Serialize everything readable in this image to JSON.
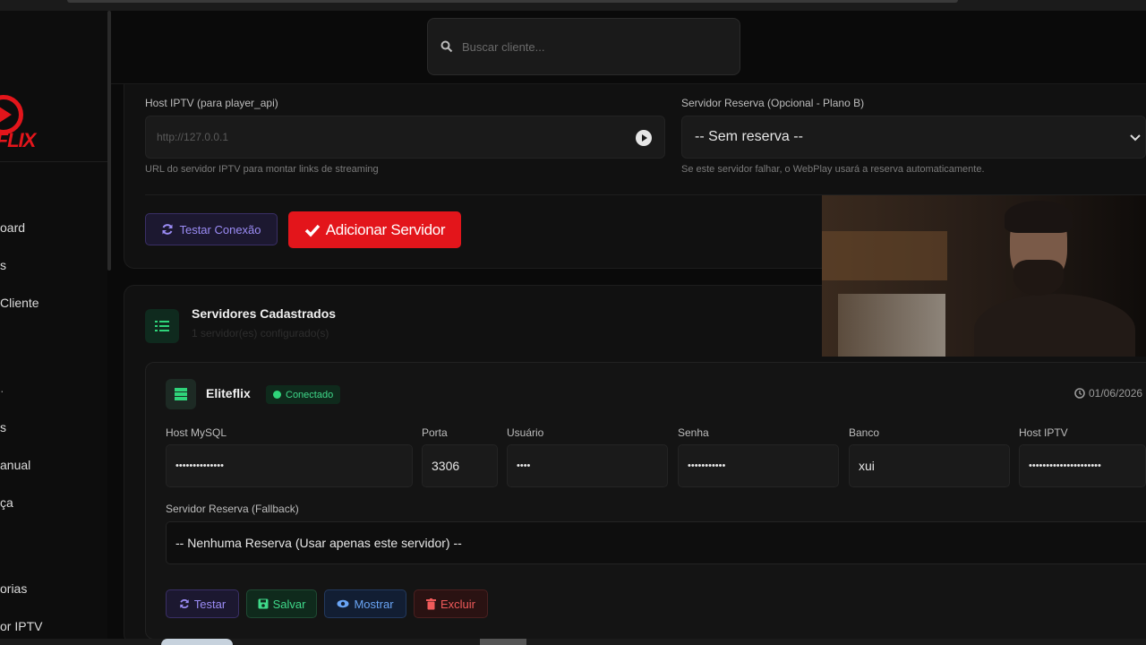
{
  "brand": {
    "logo_text": "EFLIX"
  },
  "search": {
    "placeholder": "Buscar cliente..."
  },
  "sidebar": {
    "items": [
      {
        "label": "oard"
      },
      {
        "label": "s"
      },
      {
        "label": "Cliente"
      },
      {
        "label": ""
      },
      {
        "label": "s"
      },
      {
        "label": "anual"
      },
      {
        "label": "ça"
      },
      {
        "label": "orias"
      },
      {
        "label": "or IPTV"
      }
    ]
  },
  "form": {
    "host_iptv_label": "Host IPTV (para player_api)",
    "host_iptv_placeholder": "http://127.0.0.1",
    "host_iptv_hint": "URL do servidor IPTV para montar links de streaming",
    "reserve_label": "Servidor Reserva (Opcional - Plano B)",
    "reserve_value": "-- Sem reserva --",
    "reserve_hint": "Se este servidor falhar, o WebPlay usará a reserva automaticamente.",
    "test_connection_label": "Testar Conexão",
    "add_server_label": "Adicionar Servidor"
  },
  "servers_section": {
    "title": "Servidores Cadastrados",
    "subtitle": "1 servidor(es) configurado(s)"
  },
  "server": {
    "name": "Eliteflix",
    "status": "Conectado",
    "date": "01/06/2026",
    "fields": [
      {
        "label": "Host MySQL",
        "value": "••••••••••••••"
      },
      {
        "label": "Porta",
        "value": "3306"
      },
      {
        "label": "Usuário",
        "value": "••••"
      },
      {
        "label": "Senha",
        "value": "•••••••••••"
      },
      {
        "label": "Banco",
        "value": "xui"
      },
      {
        "label": "Host IPTV",
        "value": "•••••••••••••••••••••"
      }
    ],
    "fallback_label": "Servidor Reserva (Fallback)",
    "fallback_value": "-- Nenhuma Reserva (Usar apenas este servidor) --",
    "buttons": {
      "test": "Testar",
      "save": "Salvar",
      "show": "Mostrar",
      "delete": "Excluir"
    }
  },
  "colors": {
    "accent": "#e3151b",
    "success": "#3fd98a",
    "purple": "#9b8cf5",
    "blue": "#6aa5f5",
    "danger": "#f05a5a"
  }
}
